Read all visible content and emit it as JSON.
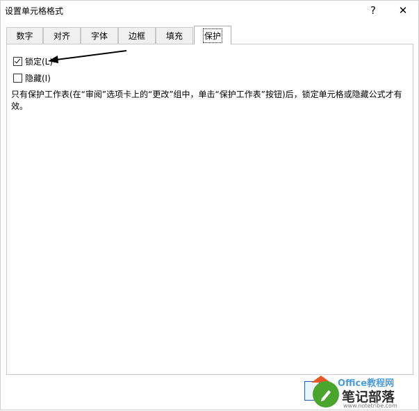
{
  "window": {
    "title": "设置单元格格式",
    "help_label": "?",
    "close_label": "✕"
  },
  "tabs": [
    {
      "label": "数字"
    },
    {
      "label": "对齐"
    },
    {
      "label": "字体"
    },
    {
      "label": "边框"
    },
    {
      "label": "填充"
    },
    {
      "label": "保护",
      "active": true
    }
  ],
  "protection": {
    "locked_label": "锁定(L)",
    "locked_checked": true,
    "hidden_label": "隐藏(I)",
    "hidden_checked": false,
    "info_text": "只有保护工作表(在“审阅”选项卡上的“更改”组中，单击“保护工作表”按钮)后，锁定单元格或隐藏公式才有效。"
  },
  "watermark": {
    "top_text": "Office教程网",
    "main_text": "笔记部落",
    "url_text": "www.notetribe.com"
  },
  "icons": {
    "help": "help-icon",
    "close": "close-icon",
    "check": "check-icon",
    "arrow": "arrow-icon"
  }
}
